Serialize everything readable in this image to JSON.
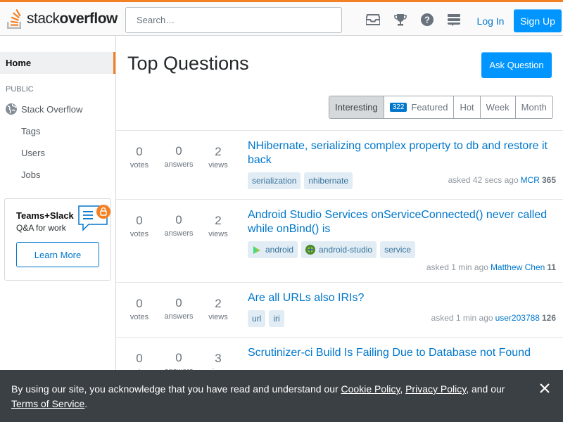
{
  "header": {
    "logo_light": "stack",
    "logo_bold": "overflow",
    "search_placeholder": "Search…",
    "icons": [
      "inbox-icon",
      "trophy-icon",
      "help-icon",
      "site-switcher-icon"
    ],
    "login_label": "Log In",
    "signup_label": "Sign Up"
  },
  "sidebar": {
    "home": "Home",
    "public_heading": "PUBLIC",
    "stackoverflow": "Stack Overflow",
    "items": [
      "Tags",
      "Users",
      "Jobs"
    ],
    "teams_title": "Teams+Slack",
    "teams_subtitle": "Q&A for work",
    "learn_more": "Learn More"
  },
  "main": {
    "title": "Top Questions",
    "ask_button": "Ask Question",
    "filters": [
      {
        "label": "Interesting",
        "active": true
      },
      {
        "label": "Featured",
        "badge": "322"
      },
      {
        "label": "Hot"
      },
      {
        "label": "Week"
      },
      {
        "label": "Month"
      }
    ],
    "stat_labels": {
      "votes": "votes",
      "answers": "answers",
      "views": "views"
    },
    "questions": [
      {
        "votes": "0",
        "answers": "0",
        "views": "2",
        "title": "NHibernate, serializing complex property to db and restore it back",
        "tags": [
          "serialization",
          "nhibernate"
        ],
        "asked": "asked 42 secs ago",
        "user": "MCR",
        "rep": "365"
      },
      {
        "votes": "0",
        "answers": "0",
        "views": "2",
        "title": "Android Studio Services onServiceConnected() never called while onBind() is",
        "tags": [
          "android",
          "android-studio",
          "service"
        ],
        "asked": "asked 1 min ago",
        "user": "Matthew Chen",
        "rep": "11"
      },
      {
        "votes": "0",
        "answers": "0",
        "views": "2",
        "title": "Are all URLs also IRIs?",
        "tags": [
          "url",
          "iri"
        ],
        "asked": "asked 1 min ago",
        "user": "user203788",
        "rep": "126"
      },
      {
        "votes": "0",
        "answers": "0",
        "views": "3",
        "title": "Scrutinizer-ci Build Is Failing Due to Database not Found"
      }
    ]
  },
  "cookie": {
    "prefix": "By using our site, you acknowledge that you have read and understand our ",
    "cookie_policy": "Cookie Policy",
    "sep1": ", ",
    "privacy_policy": "Privacy Policy",
    "sep2": ", and our ",
    "terms": "Terms of Service",
    "suffix": "."
  },
  "colors": {
    "accent": "#f48024",
    "primary_button": "#0095ff",
    "link": "#0077cc",
    "tag_bg": "#e1ecf4",
    "tag_text": "#39739d",
    "banner_bg": "#3b4045"
  }
}
